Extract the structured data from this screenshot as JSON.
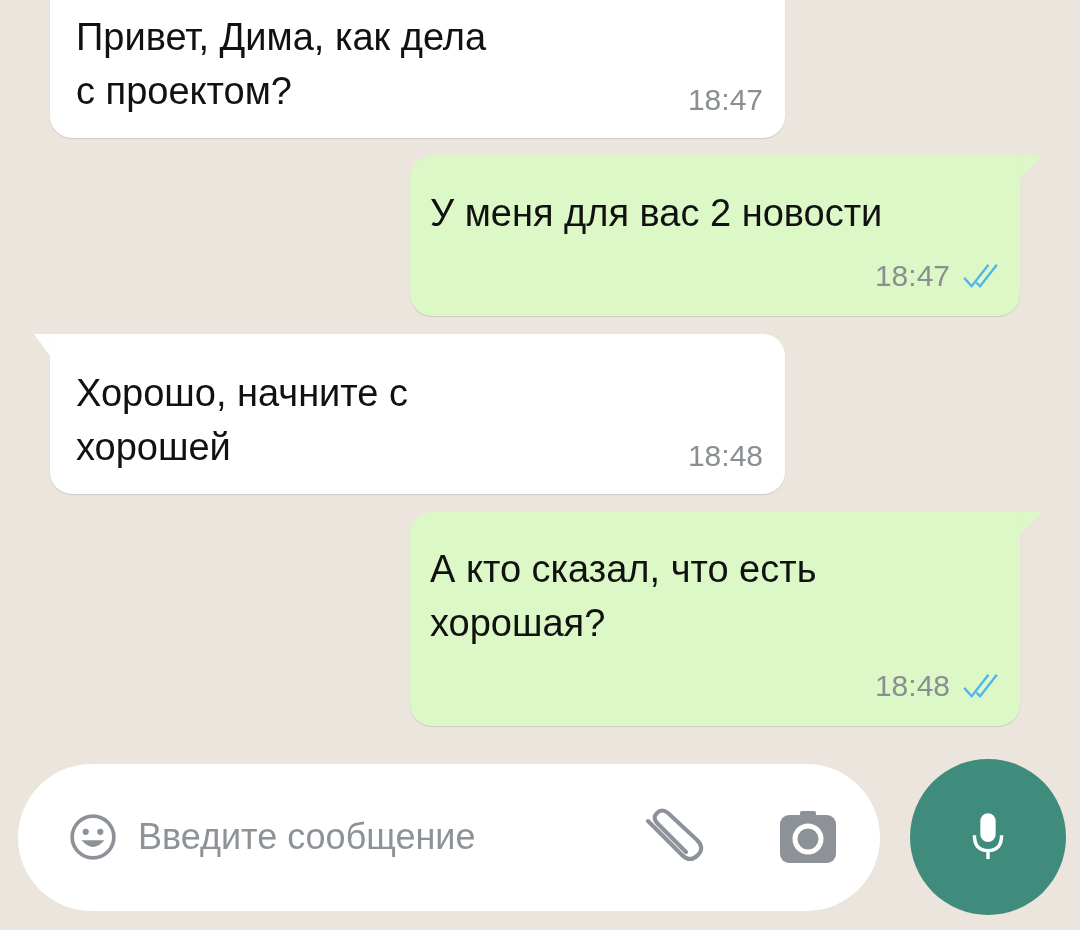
{
  "messages": [
    {
      "kind": "incoming",
      "lines": [
        "Привет, Дима, как дела",
        "с проектом?"
      ],
      "time": "18:47"
    },
    {
      "kind": "outgoing",
      "lines": [
        "У меня для вас 2 новости"
      ],
      "time": "18:47",
      "read": true
    },
    {
      "kind": "incoming",
      "lines": [
        "Хорошо, начните с",
        "хорошей"
      ],
      "time": "18:48"
    },
    {
      "kind": "outgoing",
      "lines": [
        "А кто сказал, что есть",
        "хорошая?"
      ],
      "time": "18:48",
      "read": true
    }
  ],
  "composer": {
    "placeholder": "Введите сообщение"
  }
}
